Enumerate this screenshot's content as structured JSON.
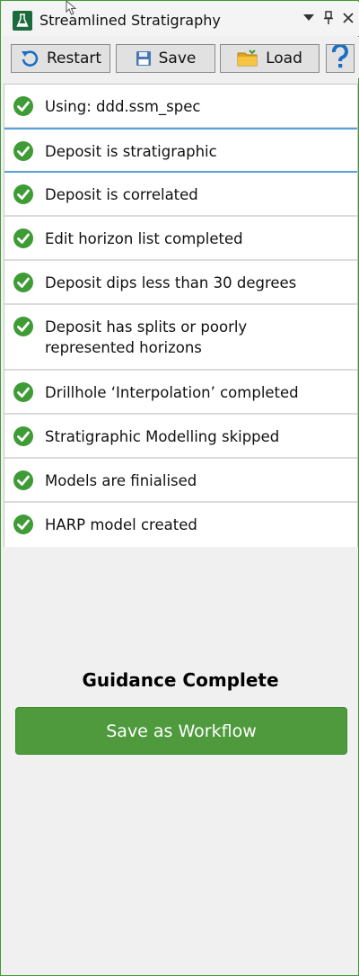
{
  "window": {
    "title": "Streamlined Stratigraphy",
    "controls": [
      "dropdown",
      "pin",
      "close"
    ]
  },
  "toolbar": {
    "restart_label": "Restart",
    "save_label": "Save",
    "load_label": "Load"
  },
  "steps": [
    {
      "label": "Using: ddd.ssm_spec",
      "status": "complete"
    },
    {
      "label": "Deposit is stratigraphic",
      "status": "complete",
      "selected": true
    },
    {
      "label": "Deposit is correlated",
      "status": "complete"
    },
    {
      "label": "Edit horizon list completed",
      "status": "complete"
    },
    {
      "label": "Deposit dips less than 30 degrees",
      "status": "complete"
    },
    {
      "label": "Deposit has splits or poorly represented horizons",
      "status": "complete"
    },
    {
      "label": "Drillhole ‘Interpolation’ completed",
      "status": "complete"
    },
    {
      "label": "Stratigraphic Modelling skipped",
      "status": "complete"
    },
    {
      "label": "Models are finialised",
      "status": "complete"
    },
    {
      "label": "HARP model created",
      "status": "complete"
    }
  ],
  "guidance": {
    "title": "Guidance Complete",
    "button_label": "Save as Workflow"
  },
  "colors": {
    "accent_green": "#4e9a3c",
    "check_green": "#3f9b35",
    "selection_blue": "#5ba0d6"
  }
}
